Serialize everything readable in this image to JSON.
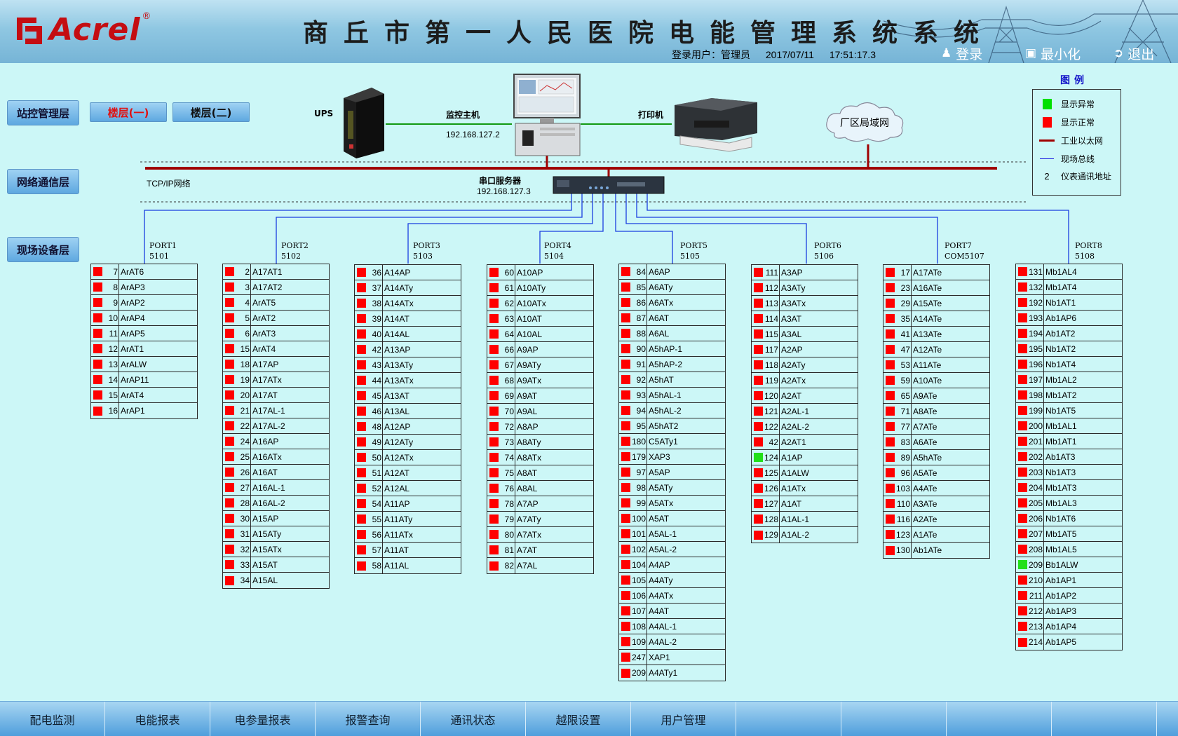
{
  "header": {
    "logo_text": "Acrel",
    "logo_reg": "®",
    "title": "商丘市第一人民医院电能管理系统系统",
    "login_user_label": "登录用户：",
    "login_user": "管理员",
    "date": "2017/07/11",
    "time": "17:51:17.3",
    "buttons": {
      "login": "登录",
      "minimize": "最小化",
      "exit": "退出"
    }
  },
  "layers": {
    "station": "站控管理层",
    "network": "网络通信层",
    "field": "现场设备层"
  },
  "floors": {
    "floor1": "楼层(一)",
    "floor2": "楼层(二)"
  },
  "topology": {
    "ups": "UPS",
    "host": "监控主机",
    "host_ip": "192.168.127.2",
    "printer": "打印机",
    "lan": "厂区局域网",
    "tcpip": "TCP/IP网络",
    "serial_server": "串口服务器",
    "serial_ip": "192.168.127.3"
  },
  "legend": {
    "title": "图例",
    "items": [
      {
        "label": "显示异常",
        "color": "#00e000"
      },
      {
        "label": "显示正常",
        "color": "#ff0000"
      },
      {
        "label": "工业以太网",
        "color": "#a00000"
      },
      {
        "label": "现场总线",
        "color": "#1a1ae0"
      },
      {
        "symbol": "2",
        "label": "仪表通讯地址"
      }
    ]
  },
  "colors": {
    "normal": "#ff0000",
    "abnormal": "#22e01a",
    "ethernet": "#a00000",
    "fieldbus": "#1a3ee0"
  },
  "ports": [
    {
      "name": "PORT1",
      "code": "5101",
      "devices": [
        {
          "n": "7",
          "name": "ArAT6"
        },
        {
          "n": "8",
          "name": "ArAP3"
        },
        {
          "n": "9",
          "name": "ArAP2"
        },
        {
          "n": "10",
          "name": "ArAP4"
        },
        {
          "n": "11",
          "name": "ArAP5"
        },
        {
          "n": "12",
          "name": "ArAT1"
        },
        {
          "n": "13",
          "name": "ArALW"
        },
        {
          "n": "14",
          "name": "ArAP11"
        },
        {
          "n": "15",
          "name": "ArAT4"
        },
        {
          "n": "16",
          "name": "ArAP1"
        }
      ]
    },
    {
      "name": "PORT2",
      "code": "5102",
      "devices": [
        {
          "n": "2",
          "name": "A17AT1"
        },
        {
          "n": "3",
          "name": "A17AT2"
        },
        {
          "n": "4",
          "name": "ArAT5"
        },
        {
          "n": "5",
          "name": "ArAT2"
        },
        {
          "n": "6",
          "name": "ArAT3"
        },
        {
          "n": "15",
          "name": "ArAT4"
        },
        {
          "n": "18",
          "name": "A17AP"
        },
        {
          "n": "19",
          "name": "A17ATx"
        },
        {
          "n": "20",
          "name": "A17AT"
        },
        {
          "n": "21",
          "name": "A17AL-1"
        },
        {
          "n": "22",
          "name": "A17AL-2"
        },
        {
          "n": "24",
          "name": "A16AP"
        },
        {
          "n": "25",
          "name": "A16ATx"
        },
        {
          "n": "26",
          "name": "A16AT"
        },
        {
          "n": "27",
          "name": "A16AL-1"
        },
        {
          "n": "28",
          "name": "A16AL-2"
        },
        {
          "n": "30",
          "name": "A15AP"
        },
        {
          "n": "31",
          "name": "A15ATy"
        },
        {
          "n": "32",
          "name": "A15ATx"
        },
        {
          "n": "33",
          "name": "A15AT"
        },
        {
          "n": "34",
          "name": "A15AL"
        }
      ]
    },
    {
      "name": "PORT3",
      "code": "5103",
      "devices": [
        {
          "n": "36",
          "name": "A14AP"
        },
        {
          "n": "37",
          "name": "A14ATy"
        },
        {
          "n": "38",
          "name": "A14ATx"
        },
        {
          "n": "39",
          "name": "A14AT"
        },
        {
          "n": "40",
          "name": "A14AL"
        },
        {
          "n": "42",
          "name": "A13AP"
        },
        {
          "n": "43",
          "name": "A13ATy"
        },
        {
          "n": "44",
          "name": "A13ATx"
        },
        {
          "n": "45",
          "name": "A13AT"
        },
        {
          "n": "46",
          "name": "A13AL"
        },
        {
          "n": "48",
          "name": "A12AP"
        },
        {
          "n": "49",
          "name": "A12ATy"
        },
        {
          "n": "50",
          "name": "A12ATx"
        },
        {
          "n": "51",
          "name": "A12AT"
        },
        {
          "n": "52",
          "name": "A12AL"
        },
        {
          "n": "54",
          "name": "A11AP"
        },
        {
          "n": "55",
          "name": "A11ATy"
        },
        {
          "n": "56",
          "name": "A11ATx"
        },
        {
          "n": "57",
          "name": "A11AT"
        },
        {
          "n": "58",
          "name": "A11AL"
        }
      ]
    },
    {
      "name": "PORT4",
      "code": "5104",
      "devices": [
        {
          "n": "60",
          "name": "A10AP"
        },
        {
          "n": "61",
          "name": "A10ATy"
        },
        {
          "n": "62",
          "name": "A10ATx"
        },
        {
          "n": "63",
          "name": "A10AT"
        },
        {
          "n": "64",
          "name": "A10AL"
        },
        {
          "n": "66",
          "name": "A9AP"
        },
        {
          "n": "67",
          "name": "A9ATy"
        },
        {
          "n": "68",
          "name": "A9ATx"
        },
        {
          "n": "69",
          "name": "A9AT"
        },
        {
          "n": "70",
          "name": "A9AL"
        },
        {
          "n": "72",
          "name": "A8AP"
        },
        {
          "n": "73",
          "name": "A8ATy"
        },
        {
          "n": "74",
          "name": "A8ATx"
        },
        {
          "n": "75",
          "name": "A8AT"
        },
        {
          "n": "76",
          "name": "A8AL"
        },
        {
          "n": "78",
          "name": "A7AP"
        },
        {
          "n": "79",
          "name": "A7ATy"
        },
        {
          "n": "80",
          "name": "A7ATx"
        },
        {
          "n": "81",
          "name": "A7AT"
        },
        {
          "n": "82",
          "name": "A7AL"
        }
      ]
    },
    {
      "name": "PORT5",
      "code": "5105",
      "devices": [
        {
          "n": "84",
          "name": "A6AP"
        },
        {
          "n": "85",
          "name": "A6ATy"
        },
        {
          "n": "86",
          "name": "A6ATx"
        },
        {
          "n": "87",
          "name": "A6AT"
        },
        {
          "n": "88",
          "name": "A6AL"
        },
        {
          "n": "90",
          "name": "A5hAP-1"
        },
        {
          "n": "91",
          "name": "A5hAP-2"
        },
        {
          "n": "92",
          "name": "A5hAT"
        },
        {
          "n": "93",
          "name": "A5hAL-1"
        },
        {
          "n": "94",
          "name": "A5hAL-2"
        },
        {
          "n": "95",
          "name": "A5hAT2"
        },
        {
          "n": "180",
          "name": "C5ATy1"
        },
        {
          "n": "179",
          "name": "XAP3"
        },
        {
          "n": "97",
          "name": "A5AP"
        },
        {
          "n": "98",
          "name": "A5ATy"
        },
        {
          "n": "99",
          "name": "A5ATx"
        },
        {
          "n": "100",
          "name": "A5AT"
        },
        {
          "n": "101",
          "name": "A5AL-1"
        },
        {
          "n": "102",
          "name": "A5AL-2"
        },
        {
          "n": "104",
          "name": "A4AP"
        },
        {
          "n": "105",
          "name": "A4ATy"
        },
        {
          "n": "106",
          "name": "A4ATx"
        },
        {
          "n": "107",
          "name": "A4AT"
        },
        {
          "n": "108",
          "name": "A4AL-1"
        },
        {
          "n": "109",
          "name": "A4AL-2"
        },
        {
          "n": "247",
          "name": "XAP1"
        },
        {
          "n": "209",
          "name": "A4ATy1"
        }
      ]
    },
    {
      "name": "PORT6",
      "code": "5106",
      "devices": [
        {
          "n": "111",
          "name": "A3AP"
        },
        {
          "n": "112",
          "name": "A3ATy"
        },
        {
          "n": "113",
          "name": "A3ATx"
        },
        {
          "n": "114",
          "name": "A3AT"
        },
        {
          "n": "115",
          "name": "A3AL"
        },
        {
          "n": "117",
          "name": "A2AP"
        },
        {
          "n": "118",
          "name": "A2ATy"
        },
        {
          "n": "119",
          "name": "A2ATx"
        },
        {
          "n": "120",
          "name": "A2AT"
        },
        {
          "n": "121",
          "name": "A2AL-1"
        },
        {
          "n": "122",
          "name": "A2AL-2"
        },
        {
          "n": "42",
          "name": "A2AT1"
        },
        {
          "n": "124",
          "name": "A1AP",
          "alarm": true
        },
        {
          "n": "125",
          "name": "A1ALW"
        },
        {
          "n": "126",
          "name": "A1ATx"
        },
        {
          "n": "127",
          "name": "A1AT"
        },
        {
          "n": "128",
          "name": "A1AL-1"
        },
        {
          "n": "129",
          "name": "A1AL-2"
        }
      ]
    },
    {
      "name": "PORT7",
      "code": "COM5107",
      "devices": [
        {
          "n": "17",
          "name": "A17ATe"
        },
        {
          "n": "23",
          "name": "A16ATe"
        },
        {
          "n": "29",
          "name": "A15ATe"
        },
        {
          "n": "35",
          "name": "A14ATe"
        },
        {
          "n": "41",
          "name": "A13ATe"
        },
        {
          "n": "47",
          "name": "A12ATe"
        },
        {
          "n": "53",
          "name": "A11ATe"
        },
        {
          "n": "59",
          "name": "A10ATe"
        },
        {
          "n": "65",
          "name": "A9ATe"
        },
        {
          "n": "71",
          "name": "A8ATe"
        },
        {
          "n": "77",
          "name": "A7ATe"
        },
        {
          "n": "83",
          "name": "A6ATe"
        },
        {
          "n": "89",
          "name": "A5hATe"
        },
        {
          "n": "96",
          "name": "A5ATe"
        },
        {
          "n": "103",
          "name": "A4ATe"
        },
        {
          "n": "110",
          "name": "A3ATe"
        },
        {
          "n": "116",
          "name": "A2ATe"
        },
        {
          "n": "123",
          "name": "A1ATe"
        },
        {
          "n": "130",
          "name": "Ab1ATe"
        }
      ]
    },
    {
      "name": "PORT8",
      "code": "5108",
      "devices": [
        {
          "n": "131",
          "name": "Mb1AL4"
        },
        {
          "n": "132",
          "name": "Mb1AT4"
        },
        {
          "n": "192",
          "name": "Nb1AT1"
        },
        {
          "n": "193",
          "name": "Ab1AP6"
        },
        {
          "n": "194",
          "name": "Ab1AT2"
        },
        {
          "n": "195",
          "name": "Nb1AT2"
        },
        {
          "n": "196",
          "name": "Nb1AT4"
        },
        {
          "n": "197",
          "name": "Mb1AL2"
        },
        {
          "n": "198",
          "name": "Mb1AT2"
        },
        {
          "n": "199",
          "name": "Nb1AT5"
        },
        {
          "n": "200",
          "name": "Mb1AL1"
        },
        {
          "n": "201",
          "name": "Mb1AT1"
        },
        {
          "n": "202",
          "name": "Ab1AT3"
        },
        {
          "n": "203",
          "name": "Nb1AT3"
        },
        {
          "n": "204",
          "name": "Mb1AT3"
        },
        {
          "n": "205",
          "name": "Mb1AL3"
        },
        {
          "n": "206",
          "name": "Nb1AT6"
        },
        {
          "n": "207",
          "name": "Mb1AT5"
        },
        {
          "n": "208",
          "name": "Mb1AL5"
        },
        {
          "n": "209",
          "name": "Bb1ALW",
          "alarm": true
        },
        {
          "n": "210",
          "name": "Ab1AP1"
        },
        {
          "n": "211",
          "name": "Ab1AP2"
        },
        {
          "n": "212",
          "name": "Ab1AP3"
        },
        {
          "n": "213",
          "name": "Ab1AP4"
        },
        {
          "n": "214",
          "name": "Ab1AP5"
        }
      ]
    }
  ],
  "bottom_nav": [
    "配电监测",
    "电能报表",
    "电参量报表",
    "报警查询",
    "通讯状态",
    "越限设置",
    "用户管理",
    "",
    "",
    "",
    "",
    ""
  ]
}
